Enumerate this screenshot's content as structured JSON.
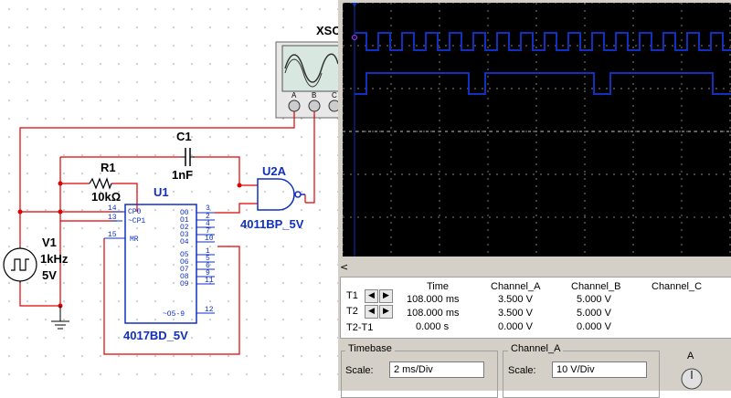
{
  "schematic": {
    "xsc_label": "XSC",
    "scope_terminals": [
      "A",
      "B",
      "C"
    ],
    "c1_name": "C1",
    "c1_value": "1nF",
    "r1_name": "R1",
    "r1_value": "10kΩ",
    "u1_name": "U1",
    "u1_part": "4017BD_5V",
    "u2_name": "U2A",
    "u2_part": "4011BP_5V",
    "v1_name": "V1",
    "v1_freq": "1kHz",
    "v1_amp": "5V",
    "u1_left_pins": [
      {
        "num": "14",
        "name": "CP0"
      },
      {
        "num": "13",
        "name": "~CP1"
      },
      {
        "num": "15",
        "name": "MR"
      }
    ],
    "u1_right_pins": [
      {
        "name": "O0",
        "num": "3"
      },
      {
        "name": "O1",
        "num": "2"
      },
      {
        "name": "O2",
        "num": "4"
      },
      {
        "name": "O3",
        "num": "7"
      },
      {
        "name": "O4",
        "num": "10"
      },
      {
        "name": "O5",
        "num": "1"
      },
      {
        "name": "O6",
        "num": "5"
      },
      {
        "name": "O7",
        "num": "6"
      },
      {
        "name": "O8",
        "num": "9"
      },
      {
        "name": "O9",
        "num": "11"
      },
      {
        "name": "~O5-9",
        "num": "12"
      }
    ]
  },
  "scope": {
    "scroll_left": "<",
    "headers": {
      "time": "Time",
      "a": "Channel_A",
      "b": "Channel_B",
      "c": "Channel_C"
    },
    "rows": [
      {
        "label": "T1",
        "time": "108.000 ms",
        "a": "3.500 V",
        "b": "5.000 V"
      },
      {
        "label": "T2",
        "time": "108.000 ms",
        "a": "3.500 V",
        "b": "5.000 V"
      },
      {
        "label": "T2-T1",
        "time": "0.000 s",
        "a": "0.000 V",
        "b": "0.000 V"
      }
    ],
    "timebase_title": "Timebase",
    "timebase_scale_label": "Scale:",
    "timebase_scale_value": "2 ms/Div",
    "channel_a_title": "Channel_A",
    "channel_a_scale_label": "Scale:",
    "channel_a_scale_value": "10  V/Div",
    "trigger_letter": "A"
  },
  "colors": {
    "wire": "#e00000",
    "component": "#1030c0",
    "trace": "#1030c0",
    "screen": "#000000"
  }
}
